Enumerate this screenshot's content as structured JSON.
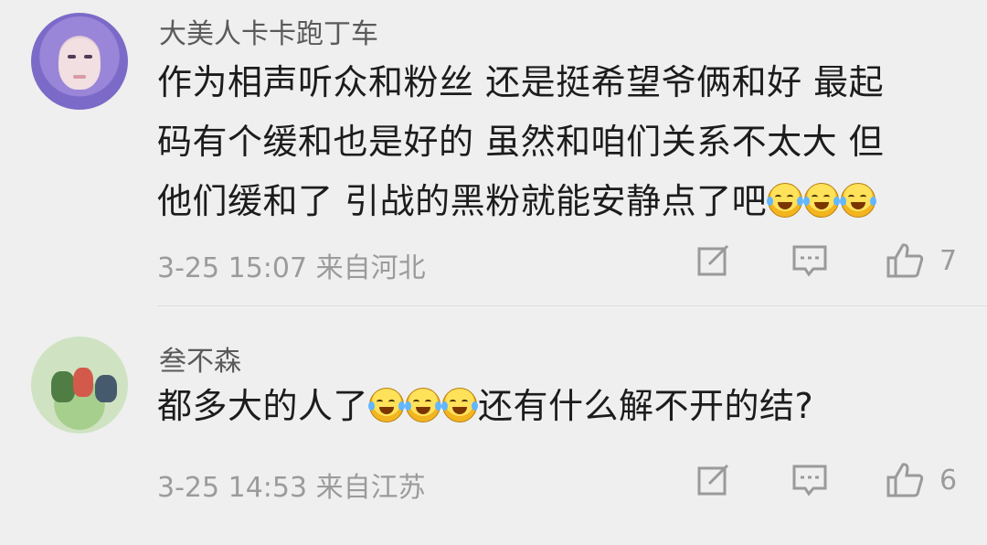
{
  "comments": [
    {
      "username": "大美人卡卡跑丁车",
      "lines": [
        "作为相声听众和粉丝 还是挺希望爷俩和好 最起",
        "码有个缓和也是好的 虽然和咱们关系不太大 但",
        "他们缓和了 引战的黑粉就能安静点了吧"
      ],
      "meta": "3-25 15:07 来自河北",
      "likes": "7"
    },
    {
      "username": "叁不森",
      "text_before": "都多大的人了",
      "text_after": "还有什么解不开的结?",
      "meta": "3-25 14:53 来自江苏",
      "likes": "6"
    }
  ],
  "icons": [
    "edit-icon",
    "comment-icon",
    "thumbs-up-icon",
    "laughing-crying-emoji"
  ],
  "colors": {
    "background": "#efefef",
    "text": "#1c1c1c",
    "secondary": "#9b9b9b"
  }
}
